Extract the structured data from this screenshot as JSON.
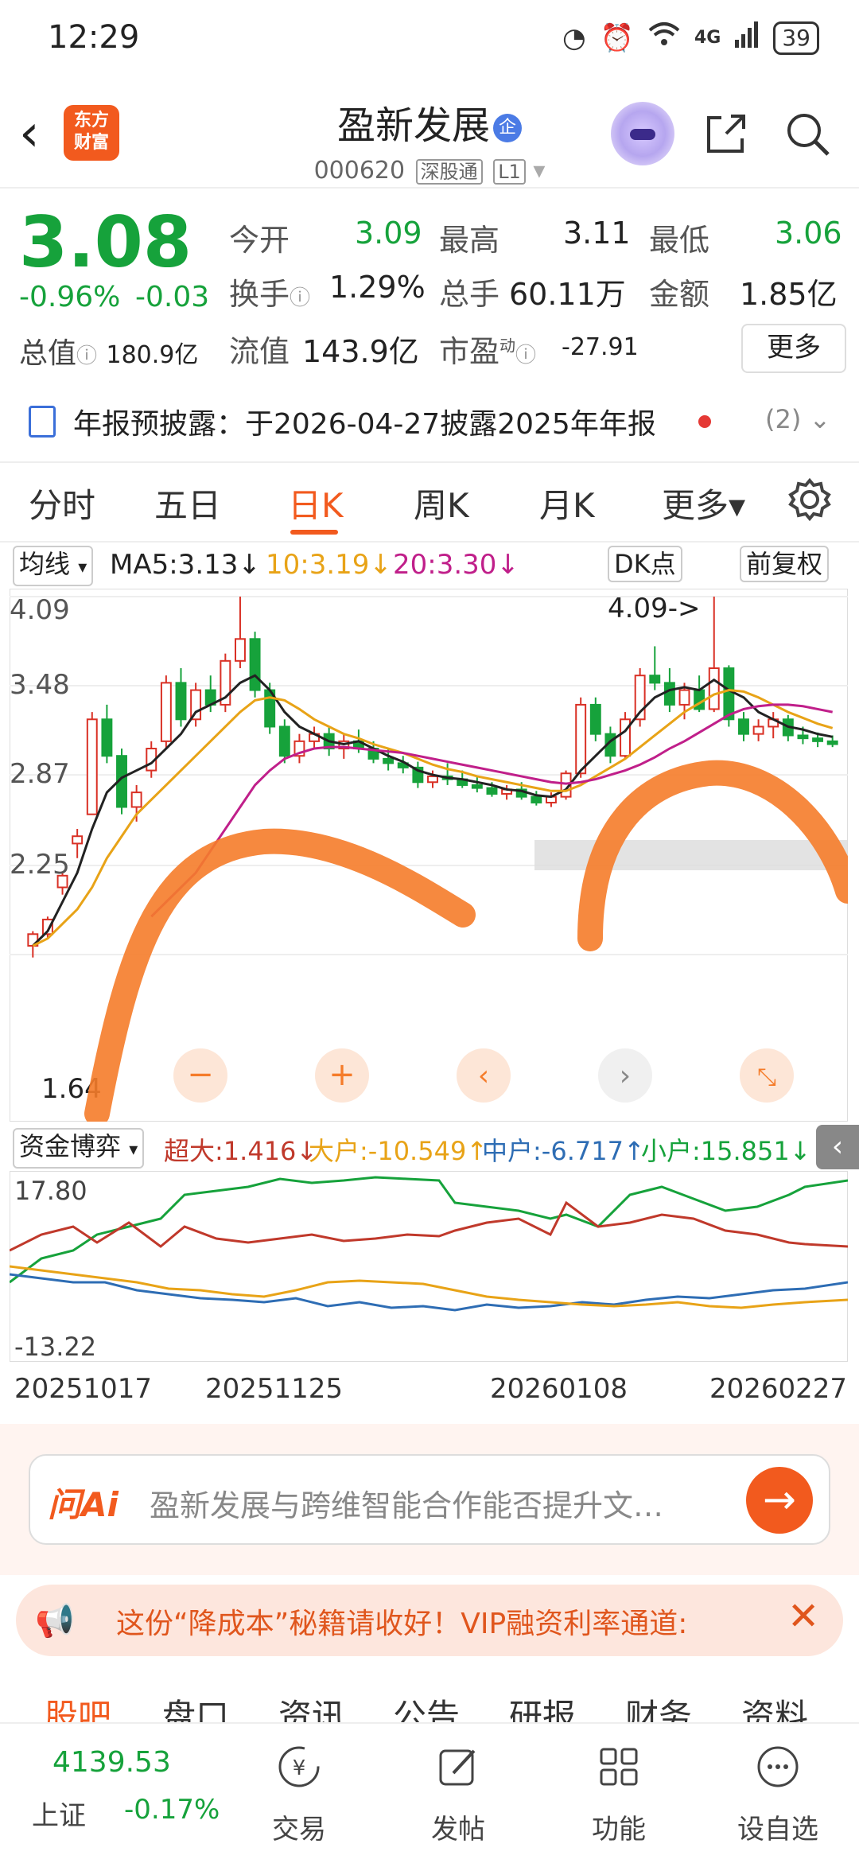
{
  "status_bar": {
    "time": "12:29",
    "battery": "39",
    "network": "4G"
  },
  "header": {
    "logo_line1": "东方",
    "logo_line2": "财富",
    "stock_name": "盈新发展",
    "name_badge": "企",
    "stock_code": "000620",
    "tag_exchange": "深股通",
    "tag_level": "L1"
  },
  "quote": {
    "price": "3.08",
    "change_pct": "-0.96%",
    "change_abs": "-0.03",
    "open_label": "今开",
    "open": "3.09",
    "high_label": "最高",
    "high": "3.11",
    "low_label": "最低",
    "low": "3.06",
    "turnover_label": "换手",
    "turnover": "1.29%",
    "volume_label": "总手",
    "volume": "60.11万",
    "amount_label": "金额",
    "amount": "1.85亿",
    "total_cap_label": "总值",
    "total_cap": "180.9亿",
    "float_cap_label": "流值",
    "float_cap": "143.9亿",
    "pe_label": "市盈",
    "pe_sup": "动",
    "pe": "-27.91",
    "more_label": "更多"
  },
  "notice": {
    "text": "年报预披露：于2026-04-27披露2025年年报",
    "count": "(2)"
  },
  "tabs": [
    {
      "label": "分时"
    },
    {
      "label": "五日"
    },
    {
      "label": "日K"
    },
    {
      "label": "周K"
    },
    {
      "label": "月K"
    },
    {
      "label": "更多▾"
    }
  ],
  "ma_bar": {
    "type_label": "均线",
    "ma5": "MA5:3.13↓",
    "ma10": "10:3.19↓",
    "ma20": "20:3.30↓",
    "dk_label": "DK点",
    "adjust_label": "前复权",
    "colors": {
      "ma5": "#222222",
      "ma10": "#e8a317",
      "ma20": "#c01f8a"
    }
  },
  "kchart": {
    "y_ticks": [
      "4.09",
      "3.48",
      "2.87",
      "2.25",
      "1.64"
    ],
    "max_marker": "4.09->",
    "min_marker": "1.64",
    "controls": [
      "zoom-out",
      "zoom-in",
      "prev",
      "next",
      "fullscreen"
    ]
  },
  "fund_bar": {
    "type_label": "资金博弈",
    "super_large": "超大:1.416↓",
    "large": "大户:-10.549↑",
    "medium": "中户:-6.717↑",
    "small": "小户:15.851↓",
    "colors": {
      "super_large": "#c0392b",
      "large": "#e8a317",
      "medium": "#2e6db4",
      "small": "#16a23b"
    }
  },
  "fund_chart": {
    "y_top": "17.80",
    "y_bottom": "-13.22"
  },
  "dates": [
    "20251017",
    "20251125",
    "20260108",
    "20260227"
  ],
  "ask": {
    "logo": "问Ai",
    "placeholder": "盈新发展与跨维智能合作能否提升文…"
  },
  "promo": {
    "text": "这份“降成本”秘籍请收好！VIP融资利率通道:"
  },
  "subtabs": [
    "股吧",
    "盘口",
    "资讯",
    "公告",
    "研报",
    "财务",
    "资料"
  ],
  "bottom": {
    "index_value": "4139.53",
    "index_name": "上证",
    "index_change": "-0.17%",
    "nav": [
      {
        "label": "交易"
      },
      {
        "label": "发帖"
      },
      {
        "label": "功能"
      },
      {
        "label": "设自选"
      }
    ]
  },
  "chart_data": {
    "type": "candlestick",
    "y_range": [
      1.64,
      4.09
    ],
    "candles": [
      [
        1.7,
        1.8,
        1.62,
        1.78
      ],
      [
        1.78,
        1.9,
        1.75,
        1.88
      ],
      [
        2.1,
        2.2,
        2.05,
        2.18
      ],
      [
        2.4,
        2.5,
        2.3,
        2.45
      ],
      [
        2.6,
        3.3,
        2.6,
        3.25
      ],
      [
        3.25,
        3.35,
        2.95,
        3.0
      ],
      [
        3.0,
        3.05,
        2.6,
        2.65
      ],
      [
        2.65,
        2.8,
        2.55,
        2.75
      ],
      [
        2.9,
        3.1,
        2.85,
        3.05
      ],
      [
        3.1,
        3.55,
        3.05,
        3.5
      ],
      [
        3.5,
        3.6,
        3.2,
        3.25
      ],
      [
        3.25,
        3.5,
        3.2,
        3.45
      ],
      [
        3.45,
        3.55,
        3.3,
        3.35
      ],
      [
        3.35,
        3.7,
        3.3,
        3.65
      ],
      [
        3.65,
        4.09,
        3.6,
        3.8
      ],
      [
        3.8,
        3.85,
        3.4,
        3.45
      ],
      [
        3.45,
        3.5,
        3.15,
        3.2
      ],
      [
        3.2,
        3.25,
        2.95,
        3.0
      ],
      [
        3.0,
        3.15,
        2.95,
        3.1
      ],
      [
        3.1,
        3.2,
        3.05,
        3.15
      ],
      [
        3.15,
        3.2,
        3.0,
        3.05
      ],
      [
        3.05,
        3.15,
        2.98,
        3.1
      ],
      [
        3.1,
        3.18,
        3.02,
        3.05
      ],
      [
        3.05,
        3.1,
        2.95,
        2.98
      ],
      [
        2.98,
        3.05,
        2.9,
        2.95
      ],
      [
        2.95,
        3.0,
        2.88,
        2.92
      ],
      [
        2.92,
        2.96,
        2.78,
        2.82
      ],
      [
        2.82,
        2.9,
        2.78,
        2.86
      ],
      [
        2.86,
        2.95,
        2.8,
        2.84
      ],
      [
        2.84,
        2.9,
        2.78,
        2.8
      ],
      [
        2.8,
        2.86,
        2.75,
        2.78
      ],
      [
        2.78,
        2.82,
        2.72,
        2.74
      ],
      [
        2.74,
        2.8,
        2.7,
        2.77
      ],
      [
        2.77,
        2.82,
        2.7,
        2.72
      ],
      [
        2.72,
        2.76,
        2.66,
        2.68
      ],
      [
        2.68,
        2.75,
        2.65,
        2.72
      ],
      [
        2.72,
        2.9,
        2.7,
        2.88
      ],
      [
        2.88,
        3.4,
        2.85,
        3.35
      ],
      [
        3.35,
        3.4,
        3.1,
        3.15
      ],
      [
        3.15,
        3.2,
        2.95,
        3.0
      ],
      [
        3.0,
        3.3,
        2.98,
        3.25
      ],
      [
        3.25,
        3.6,
        3.2,
        3.55
      ],
      [
        3.55,
        3.75,
        3.45,
        3.5
      ],
      [
        3.5,
        3.6,
        3.3,
        3.35
      ],
      [
        3.35,
        3.5,
        3.25,
        3.45
      ],
      [
        3.45,
        3.55,
        3.3,
        3.32
      ],
      [
        3.32,
        4.09,
        3.3,
        3.6
      ],
      [
        3.6,
        3.62,
        3.2,
        3.25
      ],
      [
        3.25,
        3.3,
        3.1,
        3.15
      ],
      [
        3.15,
        3.25,
        3.1,
        3.2
      ],
      [
        3.2,
        3.3,
        3.12,
        3.25
      ],
      [
        3.25,
        3.28,
        3.1,
        3.14
      ],
      [
        3.14,
        3.2,
        3.08,
        3.12
      ],
      [
        3.12,
        3.16,
        3.06,
        3.1
      ],
      [
        3.1,
        3.14,
        3.06,
        3.08
      ]
    ],
    "series": [
      {
        "name": "MA5",
        "values": [
          1.7,
          1.8,
          2.0,
          2.2,
          2.5,
          2.75,
          2.85,
          2.9,
          2.95,
          3.05,
          3.15,
          3.3,
          3.35,
          3.4,
          3.5,
          3.55,
          3.45,
          3.3,
          3.2,
          3.15,
          3.1,
          3.08,
          3.1,
          3.05,
          3.0,
          2.96,
          2.9,
          2.87,
          2.85,
          2.84,
          2.82,
          2.8,
          2.77,
          2.76,
          2.73,
          2.72,
          2.77,
          2.9,
          3.0,
          3.1,
          3.17,
          3.3,
          3.4,
          3.45,
          3.47,
          3.45,
          3.52,
          3.45,
          3.4,
          3.3,
          3.25,
          3.2,
          3.18,
          3.15,
          3.13
        ]
      },
      {
        "name": "MA10",
        "values": [
          1.7,
          1.75,
          1.85,
          1.95,
          2.1,
          2.3,
          2.45,
          2.6,
          2.7,
          2.8,
          2.9,
          3.0,
          3.1,
          3.2,
          3.3,
          3.38,
          3.4,
          3.38,
          3.32,
          3.25,
          3.2,
          3.15,
          3.12,
          3.08,
          3.05,
          3.02,
          2.98,
          2.94,
          2.91,
          2.89,
          2.86,
          2.84,
          2.82,
          2.8,
          2.78,
          2.76,
          2.76,
          2.8,
          2.86,
          2.92,
          2.98,
          3.06,
          3.14,
          3.22,
          3.3,
          3.36,
          3.42,
          3.45,
          3.44,
          3.4,
          3.35,
          3.3,
          3.26,
          3.22,
          3.19
        ]
      },
      {
        "name": "MA20",
        "values": [
          null,
          null,
          null,
          null,
          null,
          null,
          null,
          null,
          1.9,
          2.0,
          2.1,
          2.2,
          2.35,
          2.5,
          2.65,
          2.8,
          2.9,
          2.98,
          3.02,
          3.05,
          3.06,
          3.06,
          3.05,
          3.04,
          3.03,
          3.02,
          3.0,
          2.98,
          2.96,
          2.94,
          2.92,
          2.9,
          2.88,
          2.86,
          2.84,
          2.82,
          2.81,
          2.82,
          2.84,
          2.87,
          2.9,
          2.94,
          2.99,
          3.05,
          3.1,
          3.16,
          3.22,
          3.28,
          3.32,
          3.34,
          3.35,
          3.35,
          3.34,
          3.32,
          3.3
        ]
      }
    ]
  }
}
